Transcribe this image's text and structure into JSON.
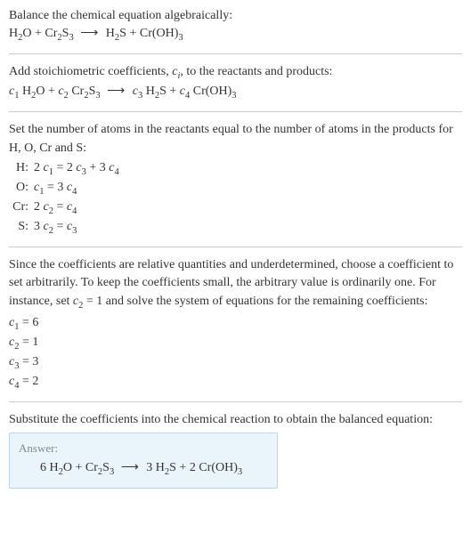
{
  "s1": {
    "instr": "Balance the chemical equation algebraically:",
    "eq_parts": {
      "r1": "H",
      "r1s": "2",
      "r1b": "O",
      "plus1": " + ",
      "r2a": "Cr",
      "r2as": "2",
      "r2b": "S",
      "r2bs": "3",
      "arrow": "⟶",
      "p1a": "H",
      "p1as": "2",
      "p1b": "S",
      "plus2": " + ",
      "p2": "Cr(OH)",
      "p2s": "3"
    }
  },
  "s2": {
    "instr_a": "Add stoichiometric coefficients, ",
    "instr_ci_c": "c",
    "instr_ci_i": "i",
    "instr_b": ", to the reactants and products:",
    "c1": "c",
    "c1s": "1",
    "c2": "c",
    "c2s": "2",
    "c3": "c",
    "c3s": "3",
    "c4": "c",
    "c4s": "4"
  },
  "s3": {
    "instr": "Set the number of atoms in the reactants equal to the number of atoms in the products for H, O, Cr and S:",
    "rows": [
      {
        "el": "H:",
        "lhs_a": "2 ",
        "lhs_c": "c",
        "lhs_s": "1",
        "eq": " = 2 ",
        "r1c": "c",
        "r1s": "3",
        "mid": " + 3 ",
        "r2c": "c",
        "r2s": "4"
      },
      {
        "el": "O:",
        "lhs_a": "",
        "lhs_c": "c",
        "lhs_s": "1",
        "eq": " = 3 ",
        "r1c": "c",
        "r1s": "4",
        "mid": "",
        "r2c": "",
        "r2s": ""
      },
      {
        "el": "Cr:",
        "lhs_a": "2 ",
        "lhs_c": "c",
        "lhs_s": "2",
        "eq": " = ",
        "r1c": "c",
        "r1s": "4",
        "mid": "",
        "r2c": "",
        "r2s": ""
      },
      {
        "el": "S:",
        "lhs_a": "3 ",
        "lhs_c": "c",
        "lhs_s": "2",
        "eq": " = ",
        "r1c": "c",
        "r1s": "3",
        "mid": "",
        "r2c": "",
        "r2s": ""
      }
    ]
  },
  "s4": {
    "instr_a": "Since the coefficients are relative quantities and underdetermined, choose a coefficient to set arbitrarily. To keep the coefficients small, the arbitrary value is ordinarily one. For instance, set ",
    "set_c": "c",
    "set_s": "2",
    "instr_b": " = 1 and solve the system of equations for the remaining coefficients:",
    "solutions": [
      {
        "c": "c",
        "s": "1",
        "eq": " = 6"
      },
      {
        "c": "c",
        "s": "2",
        "eq": " = 1"
      },
      {
        "c": "c",
        "s": "3",
        "eq": " = 3"
      },
      {
        "c": "c",
        "s": "4",
        "eq": " = 2"
      }
    ]
  },
  "s5": {
    "instr": "Substitute the coefficients into the chemical reaction to obtain the balanced equation:",
    "answer_label": "Answer:",
    "eq": {
      "a": "6 H",
      "as": "2",
      "ab": "O + Cr",
      "bs": "2",
      "bb": "S",
      "cs": "3",
      "arrow": "⟶",
      "d": "3 H",
      "ds": "2",
      "db": "S + 2 Cr(OH)",
      "es": "3"
    }
  },
  "chart_data": {
    "type": "table",
    "reaction_unbalanced": "H2O + Cr2S3 ⟶ H2S + Cr(OH)3",
    "reaction_with_coeffs": "c1 H2O + c2 Cr2S3 ⟶ c3 H2S + c4 Cr(OH)3",
    "atom_equations": {
      "H": "2 c1 = 2 c3 + 3 c4",
      "O": "c1 = 3 c4",
      "Cr": "2 c2 = c4",
      "S": "3 c2 = c3"
    },
    "chosen": "c2 = 1",
    "solution": {
      "c1": 6,
      "c2": 1,
      "c3": 3,
      "c4": 2
    },
    "reaction_balanced": "6 H2O + Cr2S3 ⟶ 3 H2S + 2 Cr(OH)3"
  }
}
